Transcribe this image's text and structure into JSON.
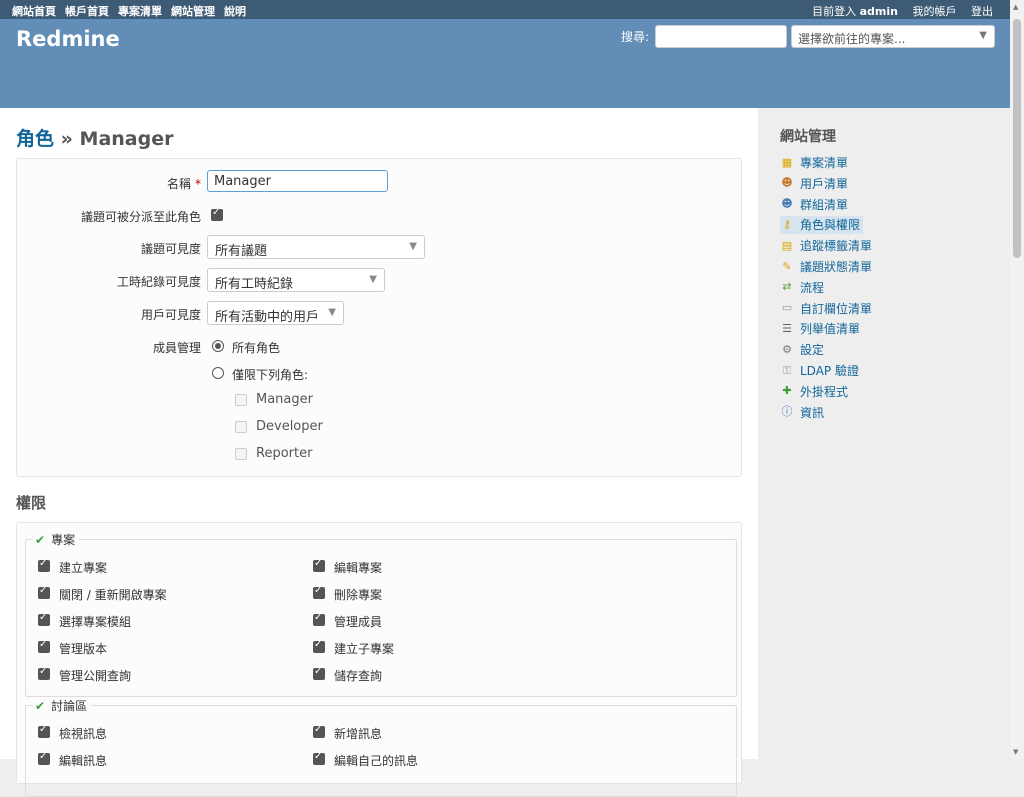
{
  "top_menu": {
    "left": [
      "網站首頁",
      "帳戶首頁",
      "專案清單",
      "網站管理",
      "說明"
    ],
    "logged_in_prefix": "目前登入",
    "user": "admin",
    "my_account": "我的帳戶",
    "logout": "登出"
  },
  "header": {
    "title": "Redmine",
    "search_label": "搜尋:",
    "search_value": "",
    "project_jump": "選擇欲前往的專案..."
  },
  "page": {
    "breadcrumb": "角色",
    "separator": "»",
    "title": "Manager"
  },
  "form": {
    "name_label": "名稱",
    "name_required": "*",
    "name_value": "Manager",
    "assignable_label": "議題可被分派至此角色",
    "assignable_checked": true,
    "issues_visibility_label": "議題可見度",
    "issues_visibility_value": "所有議題",
    "time_visibility_label": "工時紀錄可見度",
    "time_visibility_value": "所有工時紀錄",
    "users_visibility_label": "用戶可見度",
    "users_visibility_value": "所有活動中的用戶",
    "member_mgmt_label": "成員管理",
    "radio_all": "所有角色",
    "radio_all_selected": true,
    "radio_limited": "僅限下列角色:",
    "roles": [
      "Manager",
      "Developer",
      "Reporter"
    ]
  },
  "permissions": {
    "heading": "權限",
    "groups": [
      {
        "name": "專案",
        "items": [
          {
            "label": "建立專案",
            "checked": true
          },
          {
            "label": "編輯專案",
            "checked": true
          },
          {
            "label": "關閉 / 重新開啟專案",
            "checked": true
          },
          {
            "label": "刪除專案",
            "checked": true
          },
          {
            "label": "選擇專案模組",
            "checked": true
          },
          {
            "label": "管理成員",
            "checked": true
          },
          {
            "label": "管理版本",
            "checked": true
          },
          {
            "label": "建立子專案",
            "checked": true
          },
          {
            "label": "管理公開查詢",
            "checked": true
          },
          {
            "label": "儲存查詢",
            "checked": true
          }
        ]
      },
      {
        "name": "討論區",
        "items": [
          {
            "label": "檢視訊息",
            "checked": true
          },
          {
            "label": "新增訊息",
            "checked": true
          },
          {
            "label": "編輯訊息",
            "checked": true
          },
          {
            "label": "編輯自己的訊息",
            "checked": true
          }
        ]
      }
    ]
  },
  "sidebar": {
    "title": "網站管理",
    "items": [
      {
        "label": "專案清單",
        "icon": "projects-icon",
        "glyph": "▦",
        "color": "#d9a400"
      },
      {
        "label": "用戶清單",
        "icon": "user-icon",
        "glyph": "☻",
        "color": "#c77b2e"
      },
      {
        "label": "群組清單",
        "icon": "group-icon",
        "glyph": "☻",
        "color": "#4a7fb5"
      },
      {
        "label": "角色與權限",
        "icon": "key-icon",
        "glyph": "⚷",
        "color": "#d9a400",
        "selected": true
      },
      {
        "label": "追蹤標籤清單",
        "icon": "ticket-icon",
        "glyph": "▤",
        "color": "#d9a400"
      },
      {
        "label": "議題狀態清單",
        "icon": "status-icon",
        "glyph": "✎",
        "color": "#d9a400"
      },
      {
        "label": "流程",
        "icon": "workflow-icon",
        "glyph": "⇄",
        "color": "#5a9e3a"
      },
      {
        "label": "自訂欄位清單",
        "icon": "custom-field-icon",
        "glyph": "▭",
        "color": "#999999"
      },
      {
        "label": "列舉值清單",
        "icon": "list-icon",
        "glyph": "☰",
        "color": "#666666"
      },
      {
        "label": "設定",
        "icon": "gear-icon",
        "glyph": "⚙",
        "color": "#777777"
      },
      {
        "label": "LDAP 驗證",
        "icon": "ldap-icon",
        "glyph": "⚿",
        "color": "#999999"
      },
      {
        "label": "外掛程式",
        "icon": "plugin-icon",
        "glyph": "✚",
        "color": "#3a9e3a"
      },
      {
        "label": "資訊",
        "icon": "info-icon",
        "glyph": "ⓘ",
        "color": "#3a6fb5"
      }
    ]
  }
}
